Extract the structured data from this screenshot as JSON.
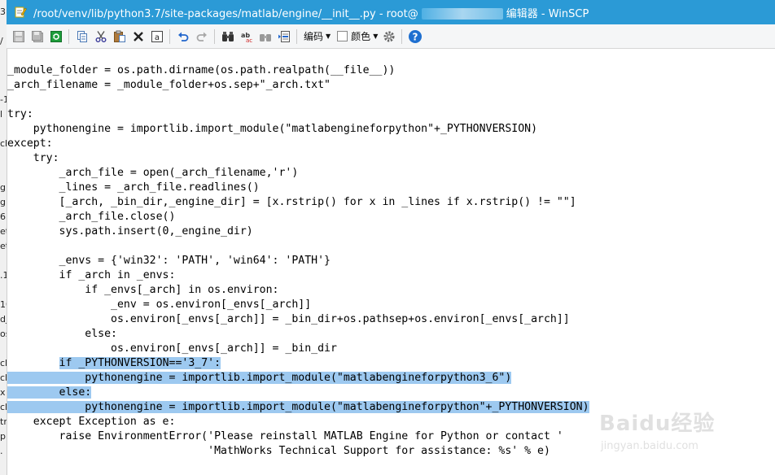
{
  "window": {
    "title_prefix": "/root/venv/lib/python3.7/site-packages/matlab/engine/__init__.py - root@",
    "title_suffix": "编辑器 - WinSCP"
  },
  "toolbar": {
    "encoding_label": "编码",
    "color_label": "颜色",
    "buttons": [
      "save-icon",
      "save-all-icon",
      "refresh-icon",
      "copy-icon",
      "cut-icon",
      "paste-icon",
      "delete-icon",
      "select-all-icon",
      "undo-icon",
      "redo-icon",
      "find-icon",
      "replace-icon",
      "find-next-icon",
      "goto-line-icon",
      "settings-icon",
      "help-icon"
    ]
  },
  "background_window": {
    "fragments": [
      "3",
      "/",
      "-1",
      "l",
      "cl",
      "g",
      "g",
      "6",
      "et",
      "et",
      ".1",
      "10",
      "dj",
      "os",
      "cl",
      "cl",
      "x",
      "cl",
      "tr",
      "p",
      "."
    ]
  },
  "code": {
    "lines": [
      "_module_folder = os.path.dirname(os.path.realpath(__file__))",
      "_arch_filename = _module_folder+os.sep+\"_arch.txt\"",
      "",
      "try:",
      "    pythonengine = importlib.import_module(\"matlabengineforpython\"+_PYTHONVERSION)",
      "except:",
      "    try:",
      "        _arch_file = open(_arch_filename,'r')",
      "        _lines = _arch_file.readlines()",
      "        [_arch, _bin_dir,_engine_dir] = [x.rstrip() for x in _lines if x.rstrip() != \"\"]",
      "        _arch_file.close()",
      "        sys.path.insert(0,_engine_dir)",
      "",
      "        _envs = {'win32': 'PATH', 'win64': 'PATH'}",
      "        if _arch in _envs:",
      "            if _envs[_arch] in os.environ:",
      "                _env = os.environ[_envs[_arch]]",
      "                os.environ[_envs[_arch]] = _bin_dir+os.pathsep+os.environ[_envs[_arch]]",
      "            else:",
      "                os.environ[_envs[_arch]] = _bin_dir",
      "        if _PYTHONVERSION=='3_7':",
      "            pythonengine = importlib.import_module(\"matlabengineforpython3_6\")",
      "        else:",
      "            pythonengine = importlib.import_module(\"matlabengineforpython\"+_PYTHONVERSION)",
      "    except Exception as e:",
      "        raise EnvironmentError('Please reinstall MATLAB Engine for Python or contact '",
      "                               'MathWorks Technical Support for assistance: %s' % e)"
    ],
    "selected_line_indices": [
      20,
      21,
      22,
      23
    ]
  },
  "watermark": {
    "logo": "Baidu经验",
    "url": "jingyan.baidu.com"
  }
}
